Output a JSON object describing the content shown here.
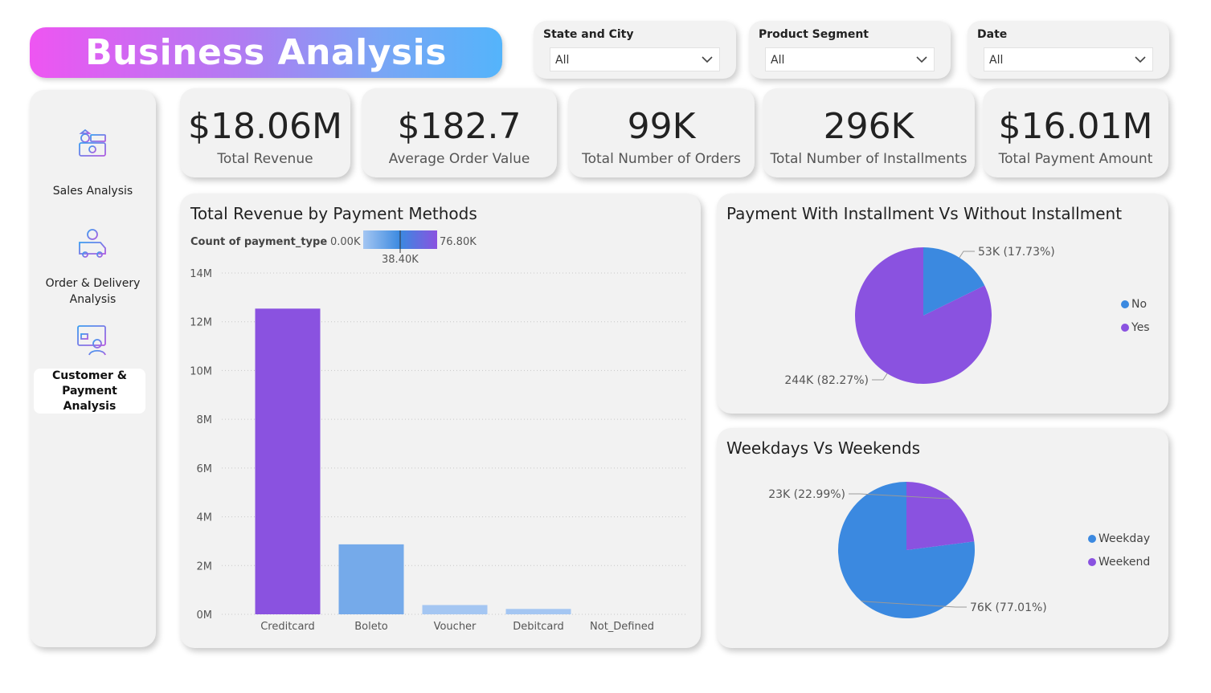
{
  "header": {
    "title": "Business Analysis"
  },
  "filters": [
    {
      "label": "State and City",
      "value": "All"
    },
    {
      "label": "Product Segment",
      "value": "All"
    },
    {
      "label": "Date",
      "value": "All"
    }
  ],
  "sidebar": {
    "items": [
      {
        "label": "Sales Analysis",
        "icon": "money-cash-icon",
        "active": false
      },
      {
        "label": "Order & Delivery Analysis",
        "icon": "delivery-truck-icon",
        "active": false
      },
      {
        "label": "Customer & Payment Analysis",
        "icon": "customer-payment-icon",
        "active": true
      }
    ]
  },
  "kpis": [
    {
      "value": "$18.06M",
      "label": "Total Revenue"
    },
    {
      "value": "$182.7",
      "label": "Average Order Value"
    },
    {
      "value": "99K",
      "label": "Total Number of Orders"
    },
    {
      "value": "296K",
      "label": "Total Number of Installments"
    },
    {
      "value": "$16.01M",
      "label": "Total Payment Amount"
    }
  ],
  "colors": {
    "purple": "#8a52e0",
    "blue": "#3b89e0",
    "light_blue": "#75aaea",
    "pale_blue": "#a4c6f2"
  },
  "chart_data": [
    {
      "type": "bar",
      "title": "Total Revenue by Payment Methods",
      "legend": {
        "title": "Count of payment_type",
        "min_label": "0.00K",
        "mid_label": "38.40K",
        "max_label": "76.80K"
      },
      "categories": [
        "Creditcard",
        "Boleto",
        "Voucher",
        "Debitcard",
        "Not_Defined"
      ],
      "values": [
        12.54,
        2.87,
        0.38,
        0.22,
        0
      ],
      "value_unit": "M",
      "colors": [
        "#8a52e0",
        "#75aaea",
        "#a4c6f2",
        "#a4c6f2",
        "#a4c6f2"
      ],
      "yticks": [
        "0M",
        "2M",
        "4M",
        "6M",
        "8M",
        "10M",
        "12M",
        "14M"
      ],
      "ylim": [
        0,
        14
      ],
      "grid": true
    },
    {
      "type": "pie",
      "title": "Payment With Installment Vs Without Installment",
      "slices": [
        {
          "name": "No",
          "value": 53,
          "percent": 17.73,
          "label": "53K (17.73%)",
          "color": "#3b89e0"
        },
        {
          "name": "Yes",
          "value": 244,
          "percent": 82.27,
          "label": "244K (82.27%)",
          "color": "#8a52e0"
        }
      ],
      "legend_position": "right"
    },
    {
      "type": "pie",
      "title": "Weekdays Vs Weekends",
      "slices": [
        {
          "name": "Weekday",
          "value": 76,
          "percent": 77.01,
          "label": "76K (77.01%)",
          "color": "#3b89e0"
        },
        {
          "name": "Weekend",
          "value": 23,
          "percent": 22.99,
          "label": "23K (22.99%)",
          "color": "#8a52e0"
        }
      ],
      "legend_position": "right"
    }
  ]
}
